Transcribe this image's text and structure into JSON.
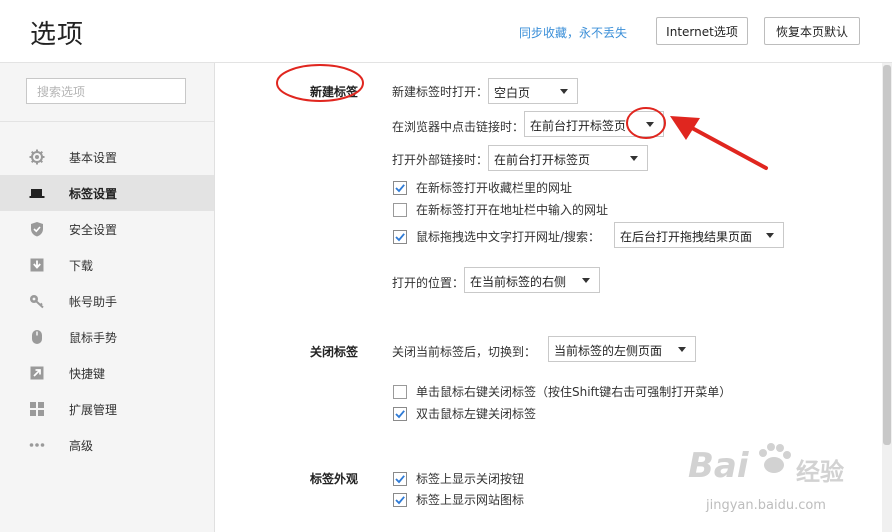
{
  "header": {
    "title": "选项",
    "sync_link": "同步收藏，永不丢失",
    "internet_button": "Internet选项",
    "restore_button": "恢复本页默认"
  },
  "sidebar": {
    "search_placeholder": "搜索选项",
    "items": [
      {
        "label": "基本设置",
        "icon": "gear-icon"
      },
      {
        "label": "标签设置",
        "icon": "tab-icon",
        "active": true
      },
      {
        "label": "安全设置",
        "icon": "shield-icon"
      },
      {
        "label": "下载",
        "icon": "download-icon"
      },
      {
        "label": "帐号助手",
        "icon": "key-icon"
      },
      {
        "label": "鼠标手势",
        "icon": "mouse-icon"
      },
      {
        "label": "快捷键",
        "icon": "shortcut-icon"
      },
      {
        "label": "扩展管理",
        "icon": "extension-icon"
      },
      {
        "label": "高级",
        "icon": "more-icon"
      }
    ]
  },
  "new_tab": {
    "section_title": "新建标签",
    "open_new_tab_label": "新建标签时打开：",
    "open_new_tab_value": "空白页",
    "click_link_label": "在浏览器中点击链接时：",
    "click_link_value": "在前台打开标签页",
    "external_link_label": "打开外部链接时：",
    "external_link_value": "在前台打开标签页",
    "check_favorites": {
      "label": "在新标签打开收藏栏里的网址",
      "checked": true
    },
    "check_addressbar": {
      "label": "在新标签打开在地址栏中输入的网址",
      "checked": false
    },
    "check_drag": {
      "label": "鼠标拖拽选中文字打开网址/搜索：",
      "checked": true
    },
    "drag_value": "在后台打开拖拽结果页面",
    "position_label": "打开的位置：",
    "position_value": "在当前标签的右侧"
  },
  "close_tab": {
    "section_title": "关闭标签",
    "after_close_label": "关闭当前标签后，切换到：",
    "after_close_value": "当前标签的左侧页面",
    "check_right_click": {
      "label": "单击鼠标右键关闭标签（按住Shift键右击可强制打开菜单）",
      "checked": false
    },
    "check_double_click": {
      "label": "双击鼠标左键关闭标签",
      "checked": true
    }
  },
  "tab_appearance": {
    "section_title": "标签外观",
    "check_close_button": {
      "label": "标签上显示关闭按钮",
      "checked": true
    },
    "check_site_icon": {
      "label": "标签上显示网站图标",
      "checked": true
    }
  },
  "watermark": {
    "brand": "Bai",
    "brand_suffix": "经验",
    "url": "jingyan.baidu.com"
  },
  "colors": {
    "accent_link": "#3b8fd8",
    "annotation_red": "#e0261f",
    "checkbox_tick": "#2f7bd6",
    "sidebar_bg": "#f5f5f5",
    "sidebar_active_bg": "#e3e3e3"
  }
}
